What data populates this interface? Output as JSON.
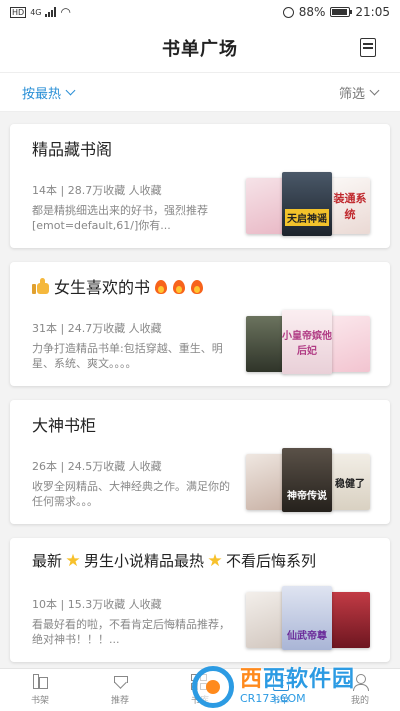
{
  "status_bar": {
    "network_hd": "HD",
    "network_gen": "4G",
    "battery": "88%",
    "time": "21:05"
  },
  "header": {
    "title": "书单广场",
    "icon": "booklist-icon"
  },
  "filter_bar": {
    "sort_label": "按最热",
    "filter_label": "筛选"
  },
  "cards": [
    {
      "title": "精品藏书阁",
      "meta": "14本 | 28.7万收藏 人收藏",
      "desc": "都是精挑细选出来的好书，强烈推荐[emot=default,61/]你有...",
      "covers": [
        {
          "text": "",
          "bg": "#f1d9df"
        },
        {
          "text": "天启神谣",
          "bg": "#2a3440"
        },
        {
          "text": "装通系统",
          "bg": "#f4f1ef"
        }
      ]
    },
    {
      "title": "女生喜欢的书",
      "meta": "31本 | 24.7万收藏 人收藏",
      "desc": "力争打造精品书单:包括穿越、重生、明星、系统、爽文。。。。",
      "covers": [
        {
          "text": "",
          "bg": "#4e5a4a"
        },
        {
          "text": "小皇帝嫔他后妃",
          "bg": "#f3e6ea"
        },
        {
          "text": "",
          "bg": "#f7dbe2"
        }
      ]
    },
    {
      "title": "大神书柜",
      "meta": "26本 | 24.5万收藏 人收藏",
      "desc": "收罗全网精品、大神经典之作。满足你的任何需求。。。",
      "covers": [
        {
          "text": "",
          "bg": "#d8cbc2"
        },
        {
          "text": "神帝传说",
          "bg": "#3a352f"
        },
        {
          "text": "稳健了",
          "bg": "#e8e3d9"
        }
      ]
    },
    {
      "title": "最新男生小说精品最热不看后悔系列",
      "title_parts": [
        "最新",
        "男生小说精品最热",
        "不看后悔系列"
      ],
      "meta": "10本 | 15.3万收藏 人收藏",
      "desc": "看最好看的啦，不看肯定后悔精品推荐，绝对神书！！！...",
      "covers": [
        {
          "text": "",
          "bg": "#f0ebe7"
        },
        {
          "text": "仙武帝尊",
          "bg": "#cfd6ea"
        },
        {
          "text": "",
          "bg": "#a1303a"
        }
      ]
    }
  ],
  "bottom_nav": [
    {
      "label": "书架",
      "icon": "bookshelf-icon"
    },
    {
      "label": "推荐",
      "icon": "diamond-icon"
    },
    {
      "label": "书库",
      "icon": "grid-icon"
    },
    {
      "label": "书单",
      "icon": "booklist-icon",
      "active": true
    },
    {
      "label": "我的",
      "icon": "user-icon"
    }
  ],
  "watermark": {
    "main_1": "西",
    "main_2": "西软件园",
    "sub": "CR173.COM"
  },
  "colors": {
    "accent": "#2a8fd6",
    "text": "#222222",
    "muted": "#888888",
    "background": "#f3f3f3"
  }
}
